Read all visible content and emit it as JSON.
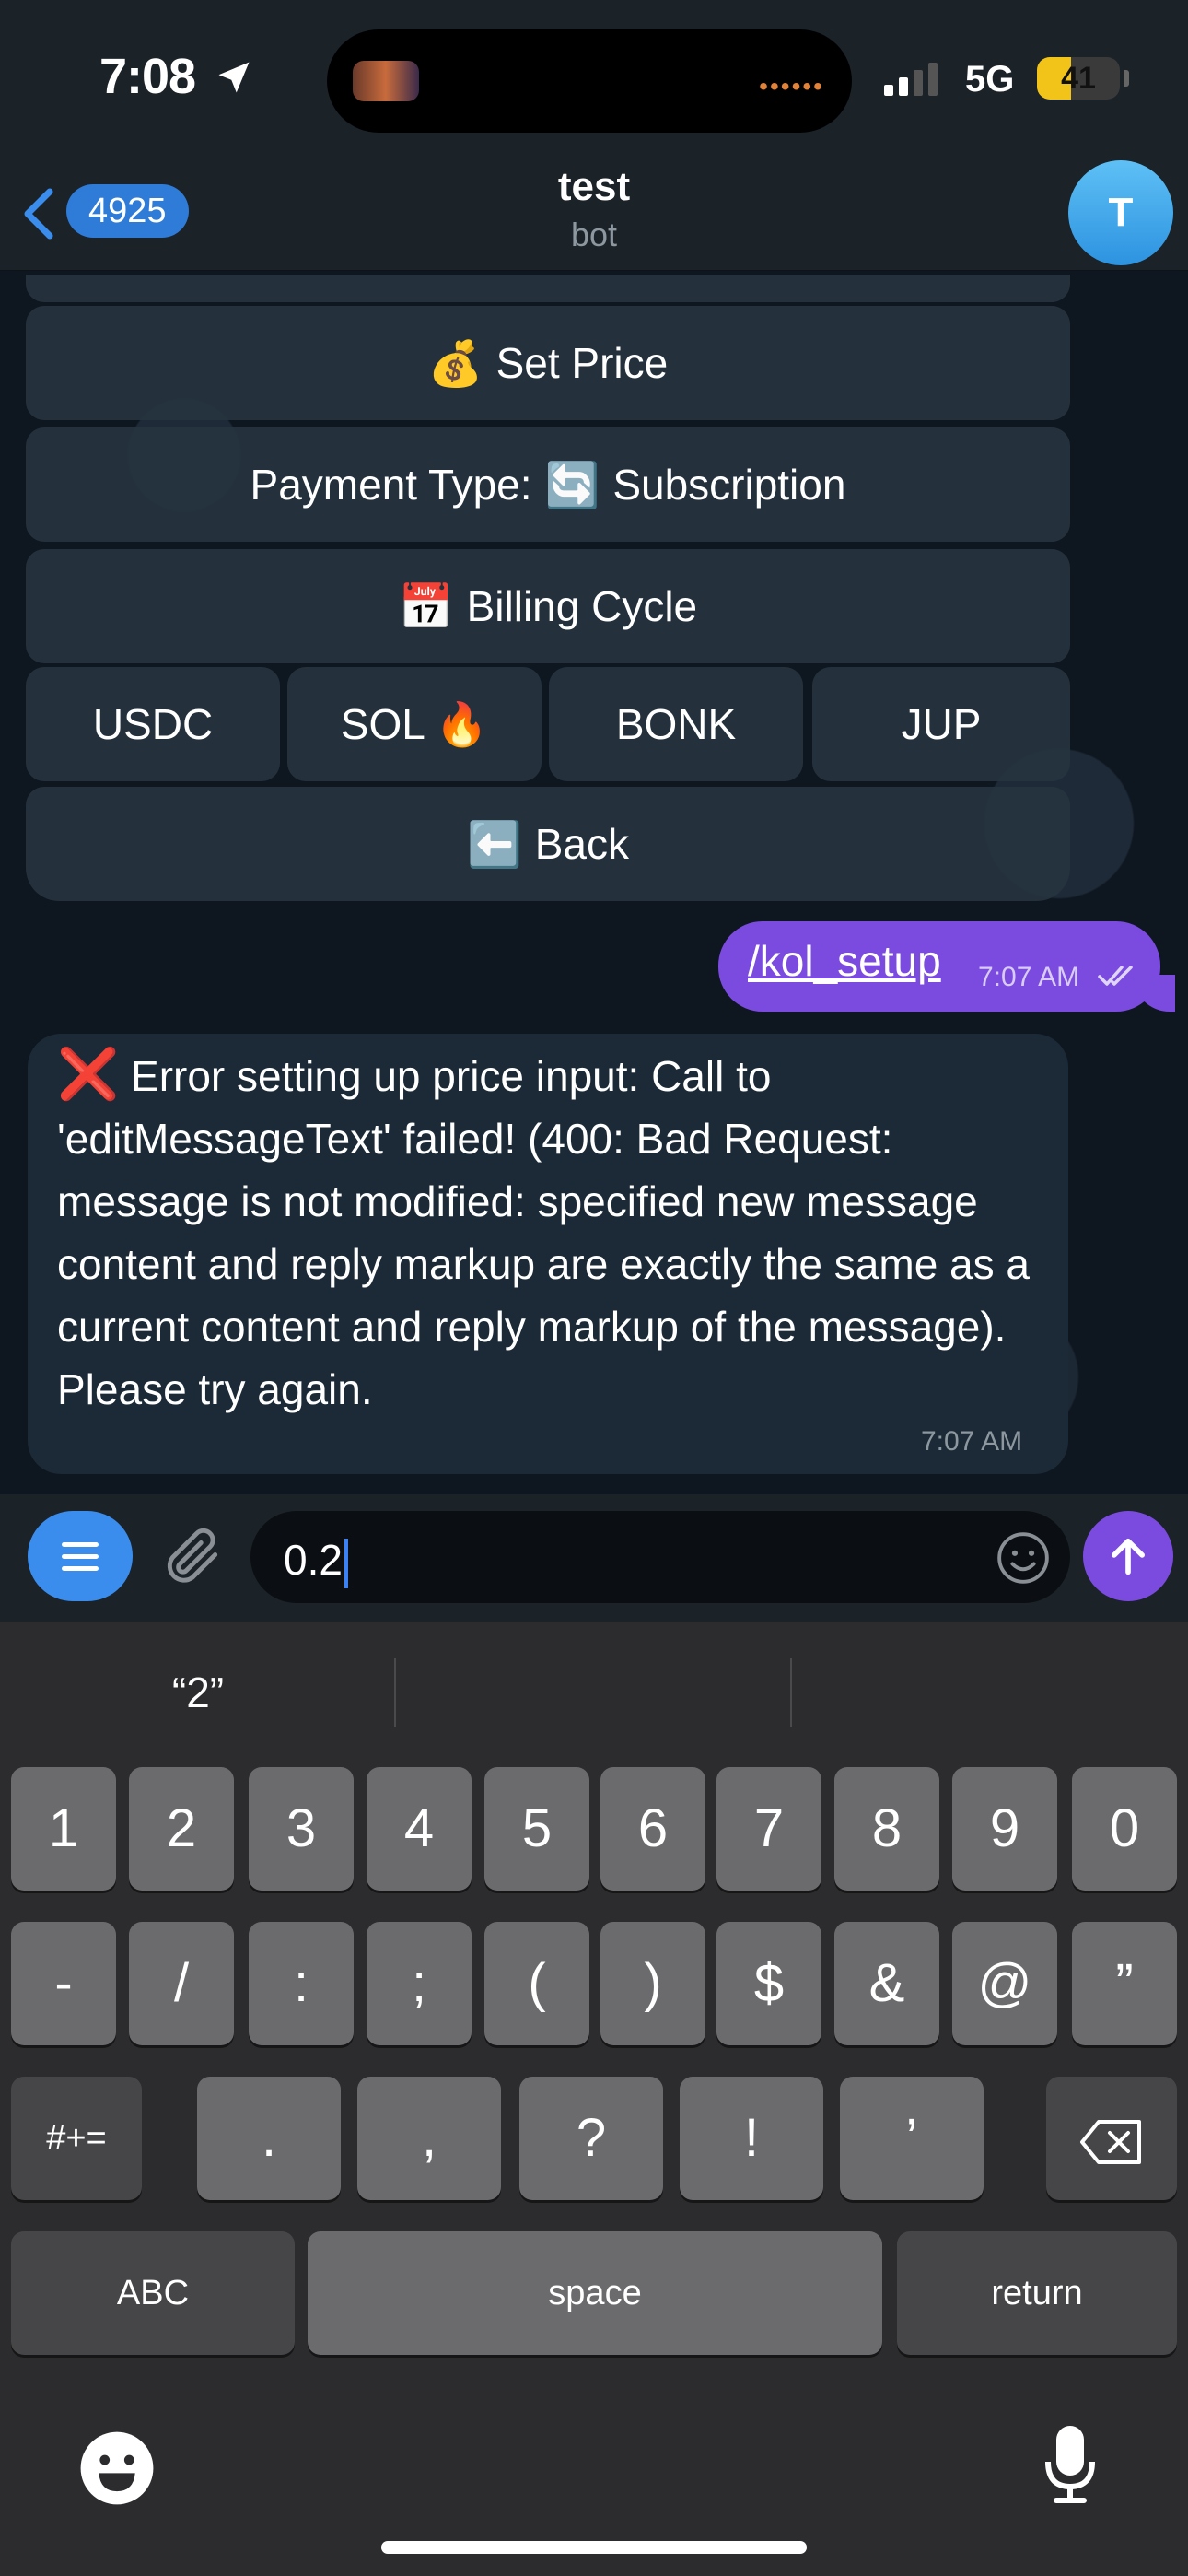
{
  "status_bar": {
    "time": "7:08",
    "network": "5G",
    "battery": "41",
    "battery_level": 0.41
  },
  "header": {
    "back_count": "4925",
    "title": "test",
    "subtitle": "bot",
    "avatar_letter": "T"
  },
  "inline_keyboard": {
    "set_price": {
      "emoji": "💰",
      "label": "Set Price"
    },
    "payment_type": {
      "label": "Payment Type:",
      "emoji": "🔄",
      "value": "Subscription"
    },
    "billing_cycle": {
      "emoji": "📅",
      "label": "Billing Cycle"
    },
    "tokens": [
      "USDC",
      "SOL 🔥",
      "BONK",
      "JUP"
    ],
    "back": {
      "emoji": "⬅️",
      "label": "Back"
    }
  },
  "outgoing_message": {
    "text": "/kol_setup",
    "time": "7:07 AM"
  },
  "incoming_message": {
    "icon": "❌",
    "text": "Error setting up price input: Call to 'editMessageText' failed! (400: Bad Request: message is not modified: specified new message content and reply markup are exactly the same as a current content and reply markup of the message). Please try again.",
    "time": "7:07 AM"
  },
  "composer": {
    "value": "0.2"
  },
  "keyboard": {
    "suggestions": [
      "“2”",
      "",
      ""
    ],
    "row1": [
      "1",
      "2",
      "3",
      "4",
      "5",
      "6",
      "7",
      "8",
      "9",
      "0"
    ],
    "row2": [
      "-",
      "/",
      ":",
      ";",
      "(",
      ")",
      "$",
      "&",
      "@",
      "”"
    ],
    "row3_left": "#+=",
    "row3": [
      ".",
      ",",
      "?",
      "!",
      "’"
    ],
    "abc": "ABC",
    "space": "space",
    "return": "return"
  }
}
